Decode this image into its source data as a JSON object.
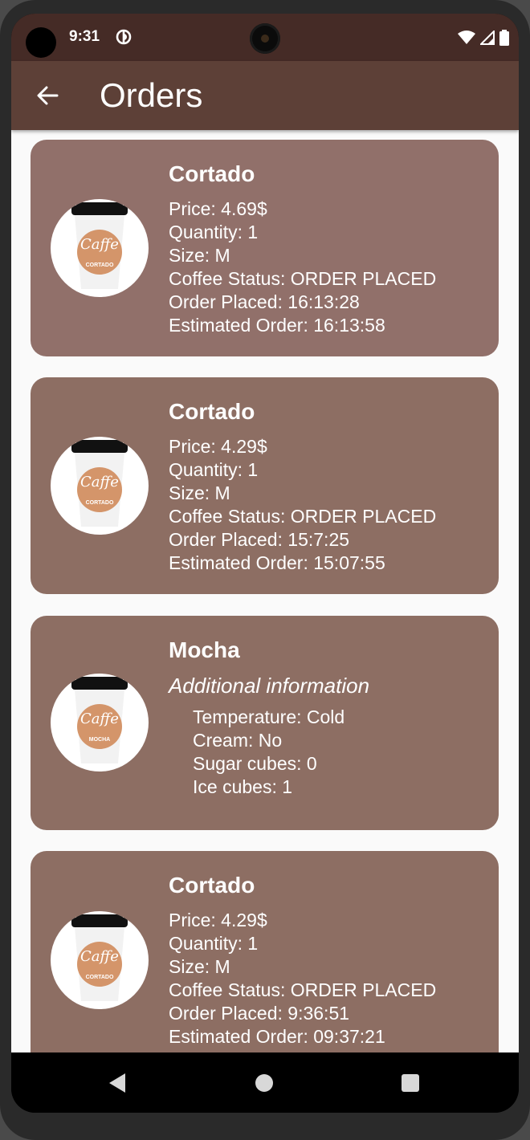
{
  "status_bar": {
    "time": "9:31"
  },
  "app_bar": {
    "title": "Orders"
  },
  "orders": [
    {
      "name": "Cortado",
      "cup_label": "CORTADO",
      "lines": [
        "Price:  4.69$",
        "Quantity: 1",
        "Size:  M",
        "Coffee Status: ORDER PLACED",
        "Order Placed:  16:13:28",
        "Estimated Order:  16:13:58"
      ]
    },
    {
      "name": "Cortado",
      "cup_label": "CORTADO",
      "lines": [
        "Price:  4.29$",
        "Quantity: 1",
        "Size:  M",
        "Coffee Status: ORDER PLACED",
        "Order Placed:  15:7:25",
        "Estimated Order:  15:07:55"
      ]
    },
    {
      "name": "Mocha",
      "cup_label": "MOCHA",
      "additional_title": "Additional information",
      "details": [
        "Temperature: Cold",
        "Cream: No",
        "Sugar cubes: 0",
        "Ice cubes: 1"
      ]
    },
    {
      "name": "Cortado",
      "cup_label": "CORTADO",
      "lines": [
        "Price:  4.29$",
        "Quantity: 1",
        "Size:  M",
        "Coffee Status: ORDER PLACED",
        "Order Placed:  9:36:51",
        "Estimated Order:  09:37:21"
      ]
    }
  ],
  "icons": {
    "back": "arrow-left-icon",
    "status_app": "app-status-icon",
    "wifi": "wifi-icon",
    "signal": "signal-icon",
    "battery": "battery-icon",
    "nav_back": "nav-back-icon",
    "nav_home": "nav-home-icon",
    "nav_recents": "nav-recents-icon"
  },
  "colors": {
    "status_bar": "#452b26",
    "app_bar": "#5d4037",
    "card": "#8d6e63",
    "background": "#fafafa"
  }
}
